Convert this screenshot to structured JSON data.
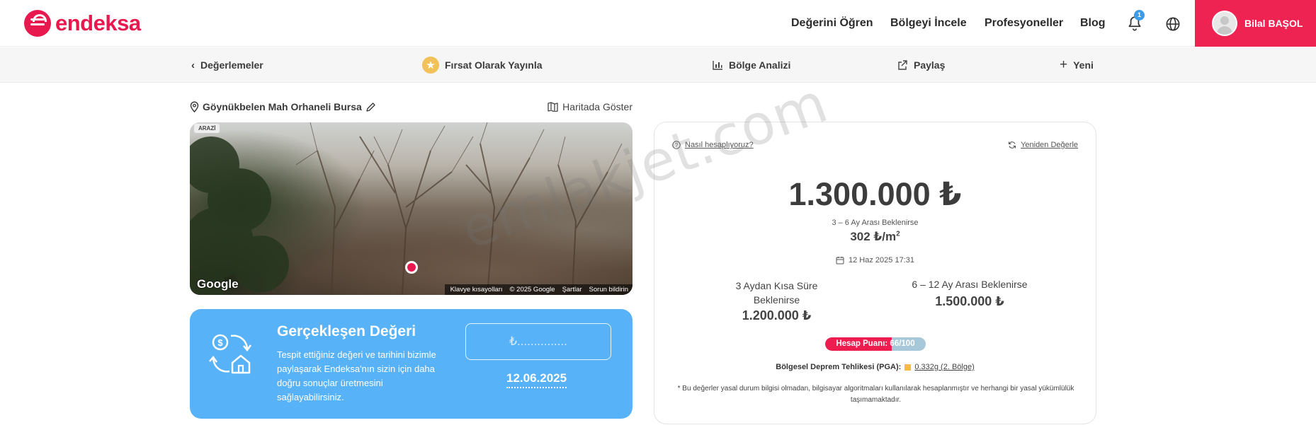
{
  "brand": {
    "name": "endeksa",
    "color": "#e8194f"
  },
  "header": {
    "nav": [
      "Değerini Öğren",
      "Bölgeyi İncele",
      "Profesyoneller",
      "Blog"
    ],
    "notification_count": "1",
    "user_name": "Bilal BAŞOL"
  },
  "subnav": {
    "back_label": "Değerlemeler",
    "publish_label": "Fırsat Olarak Yayınla",
    "analysis_label": "Bölge Analizi",
    "share_label": "Paylaş",
    "new_label": "Yeni"
  },
  "location": {
    "address": "Göynükbelen Mah Orhaneli Bursa",
    "map_link": "Haritada Göster"
  },
  "photo": {
    "tag": "ARAZİ",
    "google": "Google",
    "footer": [
      "Klavye kısayolları",
      "© 2025 Google",
      "Şartlar",
      "Sorun bildirin"
    ]
  },
  "realized": {
    "title": "Gerçekleşen Değeri",
    "description": "Tespit ettiğiniz değeri ve tarihini bizimle paylaşarak Endeksa'nın sizin için daha doğru sonuçlar üretmesini sağlayabilirsiniz.",
    "price_placeholder": "₺...............",
    "date": "12.06.2025"
  },
  "valuation": {
    "how_link": "Nasıl hesaplıyoruz?",
    "revalue_link": "Yeniden Değerle",
    "price": "1.300.000 ₺",
    "price_note": "3 – 6 Ay Arası Beklenirse",
    "per_m2": "302 ₺/m",
    "per_m2_unit": "2",
    "date": "12 Haz 2025 17:31",
    "short_label": "3 Aydan Kısa Süre Beklenirse",
    "short_price": "1.200.000 ₺",
    "long_label": "6 – 12 Ay Arası Beklenirse",
    "long_price": "1.500.000 ₺",
    "score_text": "Hesap Puanı: 66/100",
    "score_value": 66,
    "score_max": 100,
    "pga_label": "Bölgesel Deprem Tehlikesi (PGA):",
    "pga_value": "0.332g (2. Bölge)",
    "disclaimer": "* Bu değerler yasal durum bilgisi olmadan, bilgisayar algoritmaları kullanılarak hesaplanmıştır ve herhangi bir yasal yükümlülük taşımamaktadır."
  },
  "watermark": "emlakjet.com",
  "colors": {
    "accent": "#ef2352",
    "blue_card": "#57b2f8",
    "badge": "#3d9be9",
    "pga": "#f5b94c"
  }
}
